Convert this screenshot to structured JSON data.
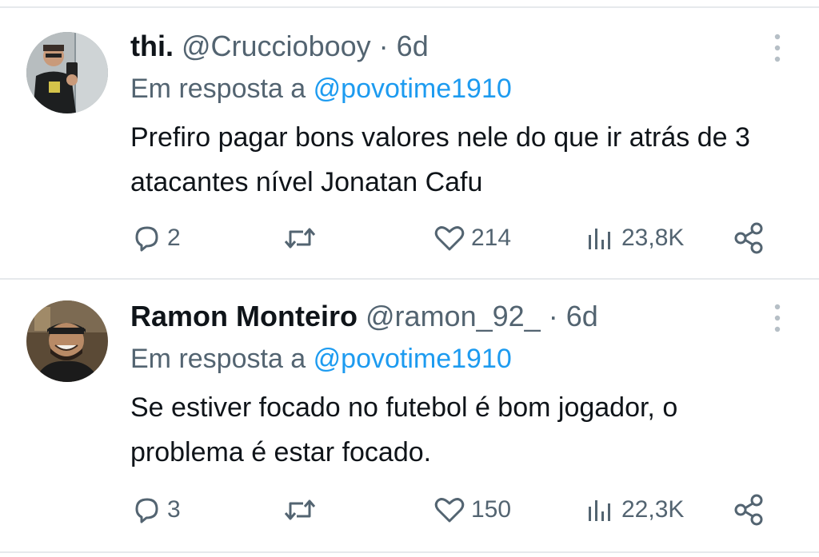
{
  "tweets": [
    {
      "name": "thi.",
      "handle": "@Crucciobooy",
      "separator": "·",
      "time": "6d",
      "reply_prefix": "Em resposta a",
      "reply_to": "@povotime1910",
      "text": "Prefiro pagar bons valores nele do que ir atrás de 3 atacantes nível Jonatan Cafu",
      "replies": "2",
      "retweets": "",
      "likes": "214",
      "views": "23,8K",
      "avatar_icon": "avatar-man-mirror-selfie"
    },
    {
      "name": "Ramon Monteiro",
      "handle": "@ramon_92_",
      "separator": "·",
      "time": "6d",
      "reply_prefix": "Em resposta a",
      "reply_to": "@povotime1910",
      "text": "Se estiver focado no futebol é bom jogador, o problema é estar focado.",
      "replies": "3",
      "retweets": "",
      "likes": "150",
      "views": "22,3K",
      "avatar_icon": "avatar-man-smiling-cap"
    }
  ],
  "colors": {
    "primary_text": "#0f1419",
    "secondary_text": "#536471",
    "link": "#1d9bf0",
    "divider": "#e6e9ec"
  }
}
